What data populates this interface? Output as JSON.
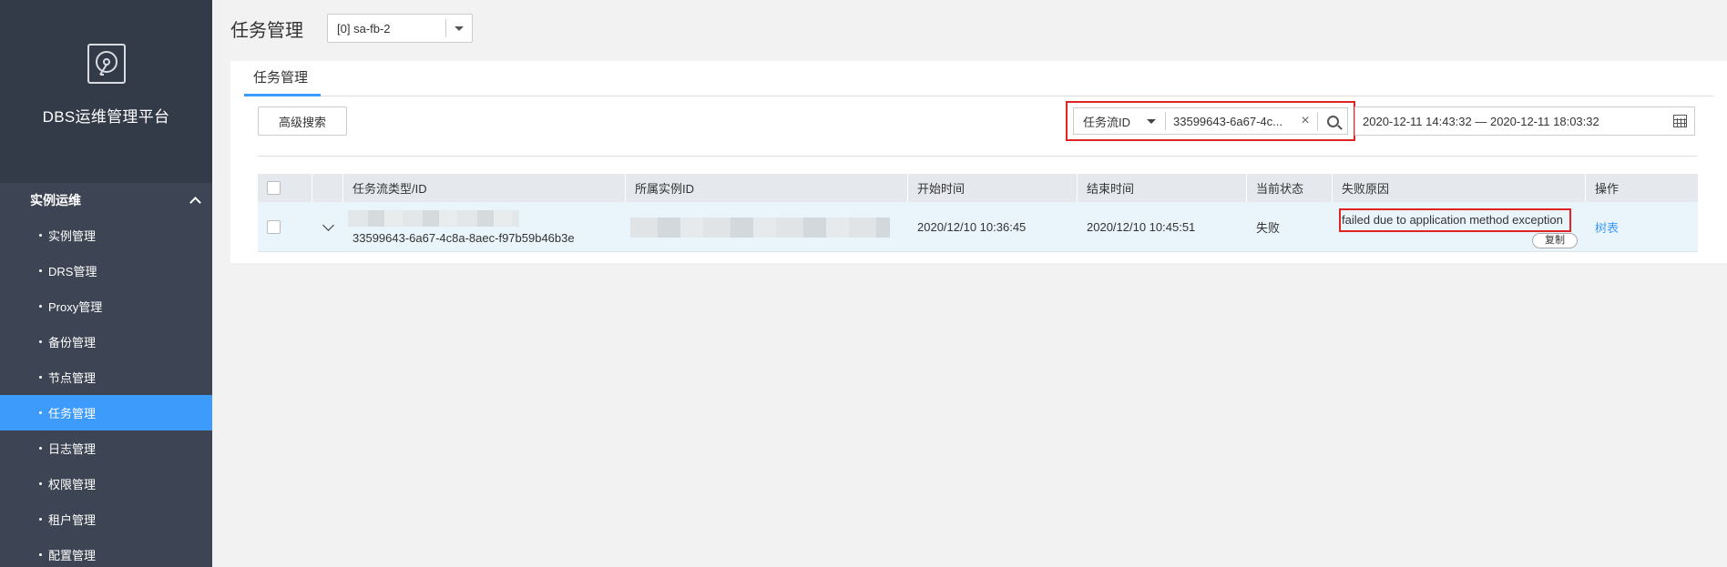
{
  "sidebar": {
    "brand_title": "DBS运维管理平台",
    "group_label": "实例运维",
    "items": [
      {
        "label": "实例管理"
      },
      {
        "label": "DRS管理"
      },
      {
        "label": "Proxy管理"
      },
      {
        "label": "备份管理"
      },
      {
        "label": "节点管理"
      },
      {
        "label": "任务管理",
        "active": true
      },
      {
        "label": "日志管理"
      },
      {
        "label": "权限管理"
      },
      {
        "label": "租户管理"
      },
      {
        "label": "配置管理"
      }
    ]
  },
  "header": {
    "title": "任务管理",
    "instance_select": "[0] sa-fb-2"
  },
  "tabs": [
    {
      "label": "任务管理"
    }
  ],
  "toolbar": {
    "advanced_search": "高级搜索",
    "filter_type": "任务流ID",
    "filter_value": "33599643-6a67-4c...",
    "clear_symbol": "×",
    "date_range": "2020-12-11 14:43:32 — 2020-12-11 18:03:32"
  },
  "table": {
    "columns": [
      "任务流类型/ID",
      "所属实例ID",
      "开始时间",
      "结束时间",
      "当前状态",
      "失败原因",
      "操作"
    ],
    "rows": [
      {
        "task_flow_id": "33599643-6a67-4c8a-8aec-f97b59b46b3e",
        "start_time": "2020/12/10 10:36:45",
        "end_time": "2020/12/10 10:45:51",
        "status": "失败",
        "failure_reason": "failed due to application method exception",
        "copy_label": "复制",
        "action": "树表"
      }
    ]
  },
  "colors": {
    "sidebar_bg": "#3d4453",
    "brand_bg": "#333a48",
    "accent": "#3d9bfb",
    "highlight_border": "#e02424",
    "row_bg": "#eaf5fb"
  }
}
